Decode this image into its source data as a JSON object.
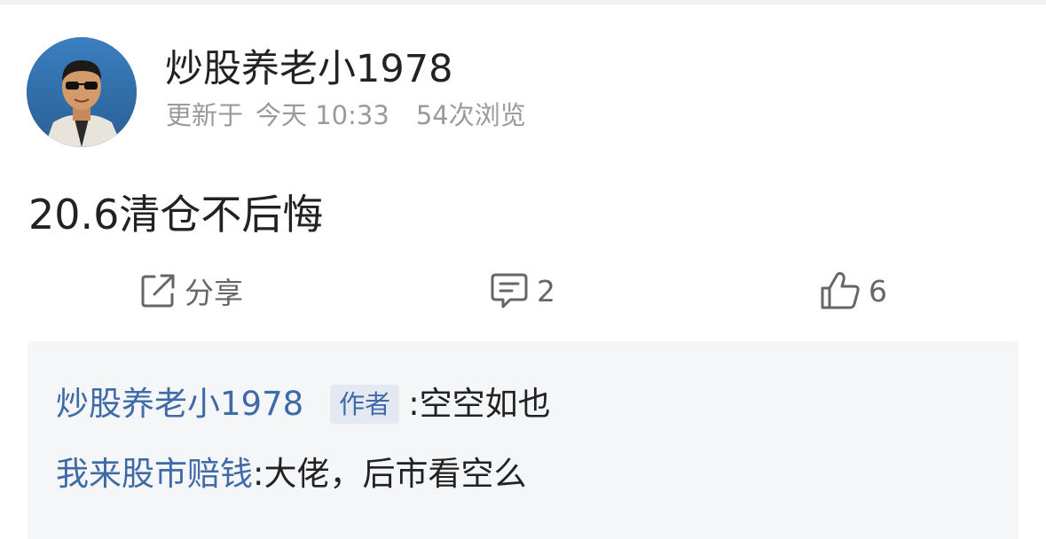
{
  "post": {
    "author": "炒股养老小1978",
    "updated_label": "更新于",
    "updated_time": "今天 10:33",
    "views": "54次浏览",
    "content": "20.6清仓不后悔"
  },
  "actions": {
    "share_label": "分享",
    "comment_count": "2",
    "like_count": "6"
  },
  "comments": [
    {
      "user": "炒股养老小1978",
      "badge": "作者",
      "text": ":空空如也"
    },
    {
      "user": "我来股市赔钱",
      "text": ":大佬，后市看空么"
    }
  ],
  "colors": {
    "link_blue": "#3e6aa8",
    "meta_gray": "#9a9a9a",
    "comment_bg": "#f5f6f8"
  },
  "icons": {
    "share": "share-icon",
    "comment": "comment-icon",
    "like": "thumbs-up-icon"
  }
}
